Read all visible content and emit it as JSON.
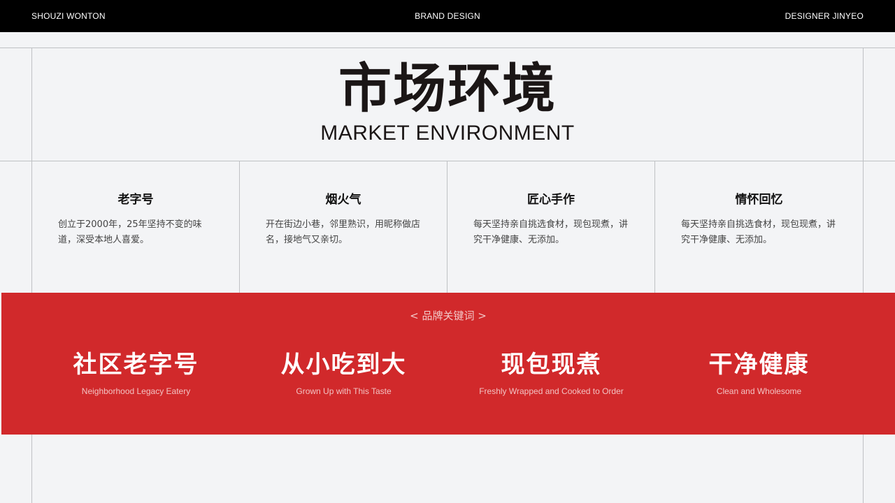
{
  "header": {
    "left": "SHOUZI WONTON",
    "center": "BRAND DESIGN",
    "right": "DESIGNER JINYEO"
  },
  "title": {
    "cn": "市场环境",
    "en": "MARKET ENVIRONMENT"
  },
  "features": [
    {
      "title": "老字号",
      "desc": "创立于2000年，25年坚持不变的味道，深受本地人喜爱。"
    },
    {
      "title": "烟火气",
      "desc": "开在街边小巷，邻里熟识，用昵称做店名，接地气又亲切。"
    },
    {
      "title": "匠心手作",
      "desc": "每天坚持亲自挑选食材，现包现煮，讲究干净健康、无添加。"
    },
    {
      "title": "情怀回忆",
      "desc": "每天坚持亲自挑选食材，现包现煮，讲究干净健康、无添加。"
    }
  ],
  "keywords": {
    "label": "< 品牌关键词 >",
    "items": [
      {
        "cn": "社区老字号",
        "en": "Neighborhood Legacy Eatery"
      },
      {
        "cn": "从小吃到大",
        "en": "Grown Up with This Taste"
      },
      {
        "cn": "现包现煮",
        "en": "Freshly Wrapped and Cooked to Order"
      },
      {
        "cn": "干净健康",
        "en": "Clean and Wholesome"
      }
    ]
  },
  "colors": {
    "accent_red": "#d1292b",
    "header_bg": "#000000",
    "page_bg": "#f3f4f6"
  }
}
